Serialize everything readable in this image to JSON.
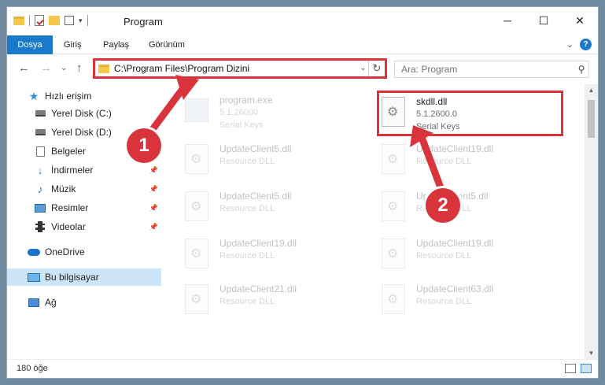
{
  "window": {
    "title": "Program",
    "controls": {
      "minimize": "─",
      "maximize": "☐",
      "close": "✕"
    }
  },
  "ribbon": {
    "tabs": [
      "Dosya",
      "Giriş",
      "Paylaş",
      "Görünüm"
    ]
  },
  "address": {
    "path": "C:\\Program Files\\Program Dizini"
  },
  "search": {
    "placeholder": "Ara: Program"
  },
  "sidebar": {
    "items": [
      {
        "label": "Hızlı erişim",
        "icon": "star-icon"
      },
      {
        "label": "Yerel Disk (C:)",
        "icon": "disk-icon"
      },
      {
        "label": "Yerel Disk (D:)",
        "icon": "disk-icon"
      },
      {
        "label": "Belgeler",
        "icon": "document-icon"
      },
      {
        "label": "İndirmeler",
        "icon": "download-icon"
      },
      {
        "label": "Müzik",
        "icon": "music-icon"
      },
      {
        "label": "Resimler",
        "icon": "pictures-icon"
      },
      {
        "label": "Videolar",
        "icon": "video-icon"
      },
      {
        "label": "OneDrive",
        "icon": "cloud-icon"
      },
      {
        "label": "Bu bilgisayar",
        "icon": "computer-icon"
      },
      {
        "label": "Ağ",
        "icon": "network-icon"
      }
    ]
  },
  "files": [
    {
      "name": "program.exe",
      "sub": "5.1.26000",
      "desc": "Serial Keys",
      "icon": "exe-icon"
    },
    {
      "name": "skdll.dll",
      "sub": "5.1.2600.0",
      "desc": "Serial Keys",
      "icon": "dll-icon"
    },
    {
      "name": "UpdateClient5.dll",
      "sub": "Resource DLL"
    },
    {
      "name": "UpdateClient19.dll",
      "sub": "Resource DLL"
    },
    {
      "name": "UpdateClient5.dll",
      "sub": "Resource DLL"
    },
    {
      "name": "UpdateClient5.dll",
      "sub": "Resource DLL"
    },
    {
      "name": "UpdateClient19.dll",
      "sub": "Resource DLL"
    },
    {
      "name": "UpdateClient19.dll",
      "sub": "Resource DLL"
    },
    {
      "name": "UpdateClient21.dll",
      "sub": "Resource DLL"
    },
    {
      "name": "UpdateClient63.dll",
      "sub": "Resource DLL"
    }
  ],
  "status": {
    "count": "180 öğe"
  },
  "annotations": {
    "badge1": "1",
    "badge2": "2",
    "accent": "#d9343c"
  }
}
